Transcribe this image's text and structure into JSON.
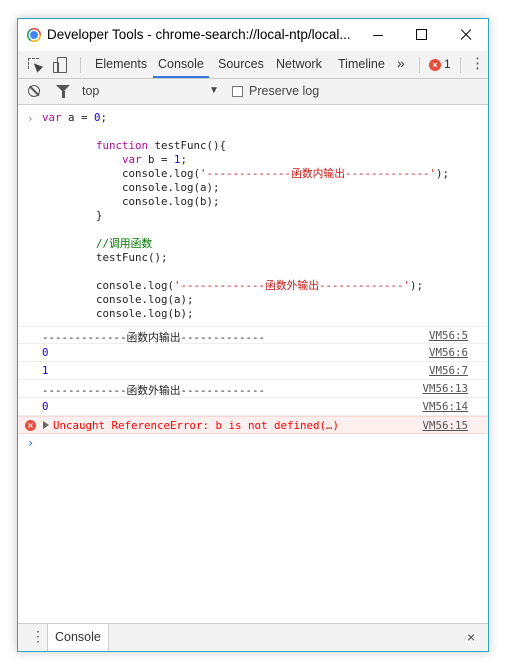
{
  "window": {
    "title": "Developer Tools - chrome-search://local-ntp/local..."
  },
  "tabs": [
    "Elements",
    "Console",
    "Sources",
    "Network",
    "Timeline"
  ],
  "active_tab": "Console",
  "error_count": "1",
  "toolbar": {
    "context": "top",
    "preserve_log": "Preserve log"
  },
  "code_input": {
    "l1": [
      "var",
      " a = ",
      "0",
      ";"
    ],
    "l2": [
      "function",
      " testFunc(){"
    ],
    "l3": [
      "var",
      " b = ",
      "1",
      ";"
    ],
    "l4": [
      "console.log(",
      "'-------------函数内输出-------------'",
      ");"
    ],
    "l5": "console.log(a);",
    "l6": "console.log(b);",
    "l7": "}",
    "l8": "//调用函数",
    "l9": "testFunc();",
    "l10": [
      "console.log(",
      "'-------------函数外输出-------------'",
      ");"
    ],
    "l11": "console.log(a);",
    "l12": "console.log(b);"
  },
  "logs": [
    {
      "text": "-------------函数内输出-------------",
      "source": "VM56:5"
    },
    {
      "text": "0",
      "source": "VM56:6"
    },
    {
      "text": "1",
      "source": "VM56:7"
    },
    {
      "text": "-------------函数外输出-------------",
      "source": "VM56:13"
    },
    {
      "text": "0",
      "source": "VM56:14"
    }
  ],
  "error": {
    "text": "Uncaught ReferenceError: b is not defined(…)",
    "source": "VM56:15"
  },
  "drawer": {
    "tab": "Console"
  },
  "icons": {
    "close": "×",
    "more": "»",
    "kebab": "⋮",
    "dropdown": "▼",
    "prompt": "›"
  }
}
